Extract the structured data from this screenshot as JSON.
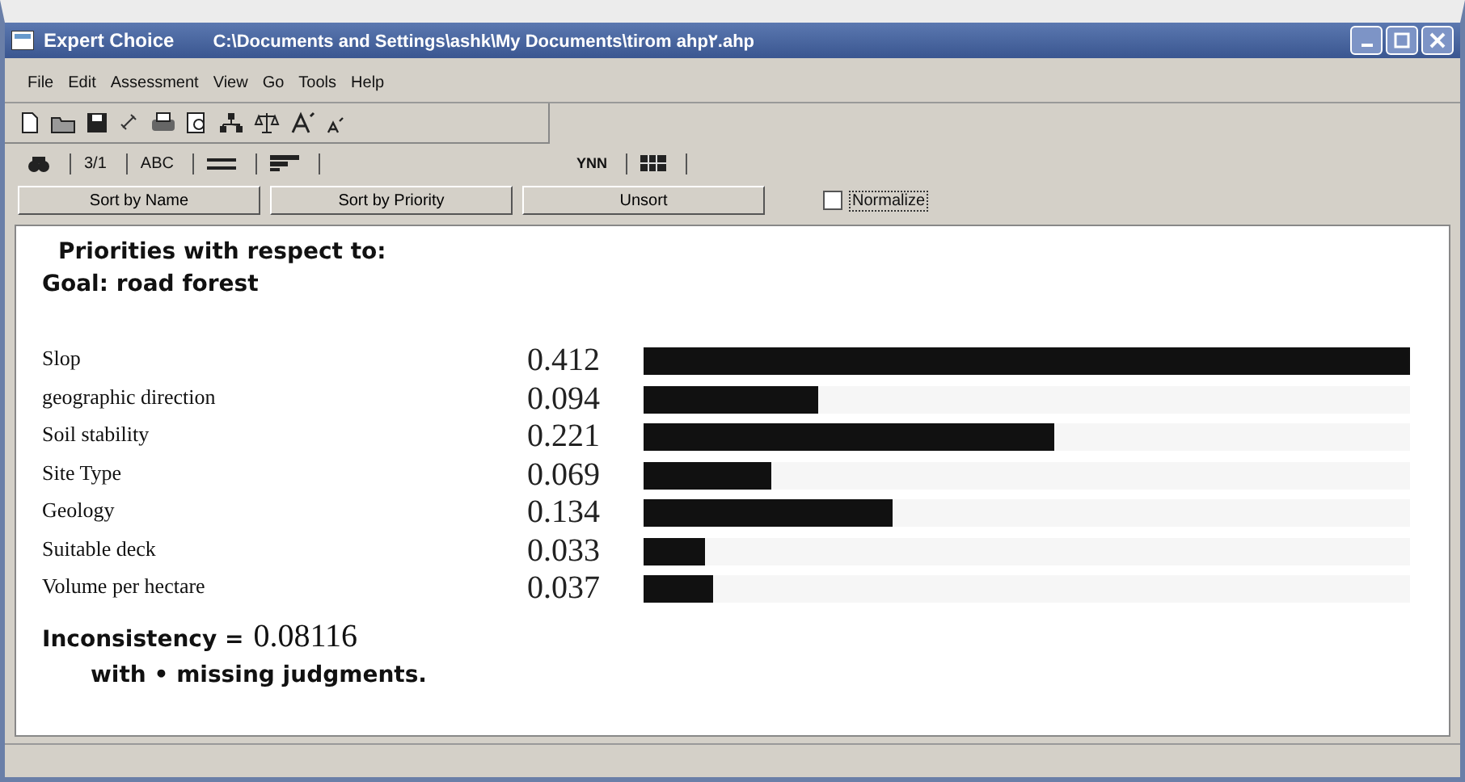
{
  "window": {
    "title": "Expert Choice",
    "path": "C:\\Documents and Settings\\ashk\\My Documents\\tirom ahp۲.ahp"
  },
  "menu": [
    "File",
    "Edit",
    "Assessment",
    "View",
    "Go",
    "Tools",
    "Help"
  ],
  "tabs": [
    {
      "kind": "icon"
    },
    {
      "kind": "text",
      "label": "3/1"
    },
    {
      "kind": "text",
      "label": "ABC"
    },
    {
      "kind": "lines"
    },
    {
      "kind": "bars"
    },
    {
      "kind": "text",
      "label": "YNN"
    },
    {
      "kind": "grid"
    }
  ],
  "buttons": [
    "Sort by Name",
    "Sort by Priority",
    "Unsort"
  ],
  "normalize": {
    "label": "Normalize",
    "checked": false
  },
  "heading": "Priorities with respect to:",
  "goal": "Goal: road forest",
  "items": [
    {
      "name": "Slop",
      "value": "0.412",
      "level": 1
    },
    {
      "name": "geographic direction",
      "value": "0.094",
      "level": 0.228
    },
    {
      "name": "Soil stability",
      "value": "0.221",
      "level": 0.536
    },
    {
      "name": "Site Type",
      "value": "0.069",
      "level": 0.167
    },
    {
      "name": "Geology",
      "value": "0.134",
      "level": 0.325
    },
    {
      "name": "Suitable deck",
      "value": "0.033",
      "level": 0.08
    },
    {
      "name": "Volume per hectare",
      "value": "0.037",
      "level": 0.09
    }
  ],
  "inconsistency": {
    "label": "Inconsistency =",
    "value": "0.08116"
  },
  "missing": "with • missing judgments."
}
